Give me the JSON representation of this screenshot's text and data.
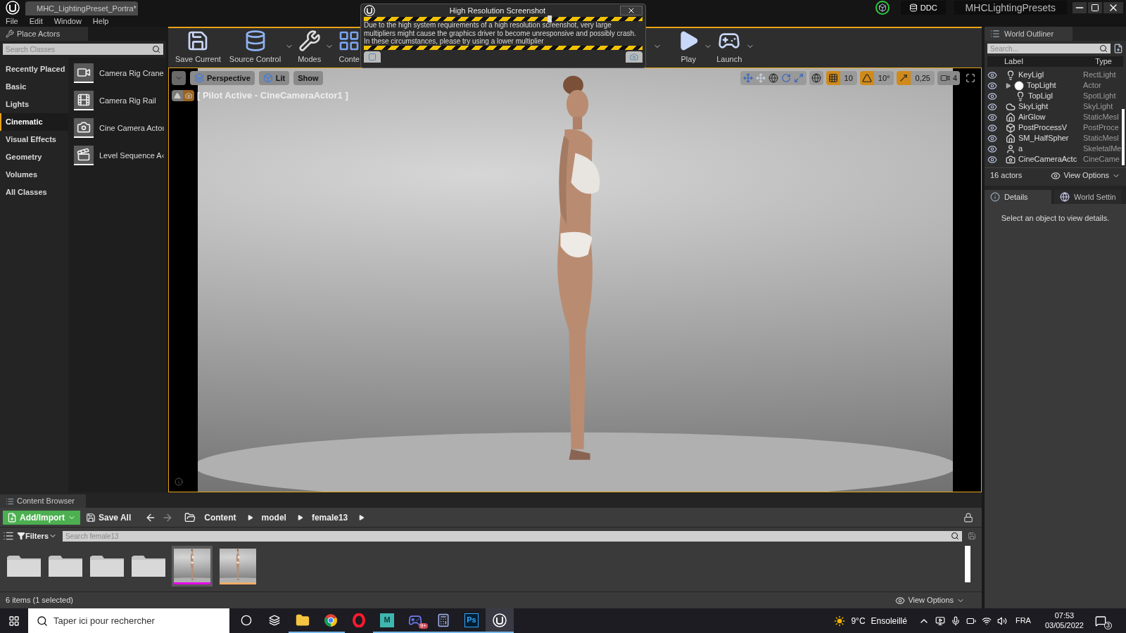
{
  "title_bar": {
    "tab": "MHC_LightingPreset_Portra*",
    "ddc": "DDC",
    "project": "MHCLightingPresets"
  },
  "menu": [
    "File",
    "Edit",
    "Window",
    "Help"
  ],
  "place_actors": {
    "title": "Place Actors",
    "search_placeholder": "Search Classes",
    "categories": [
      {
        "label": "Recently Placed",
        "selected": false
      },
      {
        "label": "Basic",
        "selected": false
      },
      {
        "label": "Lights",
        "selected": false
      },
      {
        "label": "Cinematic",
        "selected": true
      },
      {
        "label": "Visual Effects",
        "selected": false
      },
      {
        "label": "Geometry",
        "selected": false
      },
      {
        "label": "Volumes",
        "selected": false
      },
      {
        "label": "All Classes",
        "selected": false
      }
    ],
    "items": [
      {
        "label": "Camera Rig Crane",
        "kind": "crane"
      },
      {
        "label": "Camera Rig Rail",
        "kind": "rail"
      },
      {
        "label": "Cine Camera Actoı",
        "kind": "camera"
      },
      {
        "label": "Level Sequence A‹",
        "kind": "sequence"
      }
    ]
  },
  "toolbar": {
    "left": [
      {
        "label": "Save Current",
        "kind": "save",
        "menu": false
      },
      {
        "label": "Source Control",
        "kind": "source",
        "menu": true
      },
      {
        "label": "Modes",
        "kind": "modes",
        "menu": true
      },
      {
        "label": "Conte",
        "kind": "content",
        "menu": false
      }
    ],
    "right": [
      {
        "label": "Play",
        "kind": "play",
        "menu": true
      },
      {
        "label": "Launch",
        "kind": "launch",
        "menu": true
      }
    ]
  },
  "screenshot_dialog": {
    "title": "High Resolution Screenshot",
    "message": "Due to the high system requirements of a high resolution screenshot, very large multipliers might cause the graphics driver to become unresponsive and possibly crash. In these circumstances, please try using a lower multiplier",
    "multiplier": {
      "level": 0.66
    }
  },
  "viewport": {
    "view_buttons": [
      {
        "label": "Perspective",
        "kind": "perspective"
      },
      {
        "label": "Lit",
        "kind": "lit"
      },
      {
        "label": "Show",
        "kind": "show"
      }
    ],
    "pilot_label": "[ Pilot Active - CineCameraActor1 ]",
    "snaps": [
      {
        "kind": "grid",
        "value": "10",
        "on": true
      },
      {
        "kind": "rotation",
        "value": "10°",
        "on": true
      },
      {
        "kind": "scale",
        "value": "0,25",
        "on": true
      }
    ],
    "camera_speed": "4"
  },
  "world_outliner": {
    "title": "World Outliner",
    "search_placeholder": "Search...",
    "columns": [
      "Label",
      "Type"
    ],
    "rows": [
      {
        "label": "KeyLigl",
        "type": "RectLight",
        "kind": "rectlight"
      },
      {
        "label": "TopLight",
        "type": "Actor",
        "kind": "actor",
        "expanded": true,
        "children": [
          {
            "label": "TopLigl",
            "type": "SpotLight",
            "kind": "spotlight"
          }
        ]
      },
      {
        "label": "SkyLight",
        "type": "SkyLight",
        "kind": "skylight"
      },
      {
        "label": "AirGlow",
        "type": "StaticMesl",
        "kind": "mesh"
      },
      {
        "label": "PostProcessV",
        "type": "PostProce",
        "kind": "postprocess"
      },
      {
        "label": "SM_HalfSpher",
        "type": "StaticMesl",
        "kind": "mesh"
      },
      {
        "label": "a",
        "type": "SkeletalMe",
        "kind": "skeletal"
      },
      {
        "label": "CineCameraActc",
        "type": "CineCame",
        "kind": "camera"
      }
    ],
    "actor_count": "16 actors",
    "view_options": "View Options"
  },
  "details": {
    "tabs": [
      {
        "label": "Details",
        "selected": true
      },
      {
        "label": "World Settin",
        "selected": false
      }
    ],
    "empty_message": "Select an object to view details."
  },
  "content_browser": {
    "title": "Content Browser",
    "add_import": "Add/Import",
    "save_all": "Save All",
    "path": [
      "Content",
      "model",
      "female13"
    ],
    "filters": "Filters",
    "search_placeholder": "Search female13",
    "assets": [
      {
        "kind": "folder",
        "selected": false
      },
      {
        "kind": "folder",
        "selected": false
      },
      {
        "kind": "folder",
        "selected": false
      },
      {
        "kind": "folder",
        "selected": false
      },
      {
        "kind": "picture",
        "selected": true,
        "color": "#e600e6"
      },
      {
        "kind": "picture",
        "selected": false,
        "color": "#f5ad6b"
      }
    ],
    "status": "6 items (1 selected)",
    "view_options": "View Options"
  },
  "taskbar": {
    "search_placeholder": "Taper ici pour rechercher",
    "apps": [
      {
        "kind": "cortana",
        "open": false,
        "active": false
      },
      {
        "kind": "taskview",
        "open": false,
        "active": false
      },
      {
        "kind": "explorer",
        "open": true,
        "active": false
      },
      {
        "kind": "chrome",
        "open": true,
        "active": false
      },
      {
        "kind": "opera",
        "open": false,
        "active": false
      },
      {
        "kind": "maya",
        "label": "M",
        "open": true,
        "active": false
      },
      {
        "kind": "discord",
        "badge": "9+",
        "open": true,
        "active": false
      },
      {
        "kind": "calculator",
        "open": true,
        "active": false
      },
      {
        "kind": "photoshop",
        "label": "Ps",
        "open": true,
        "active": false
      },
      {
        "kind": "unreal",
        "open": true,
        "active": true
      }
    ],
    "temperature": "9°C",
    "condition": "Ensoleillé",
    "language": "FRA",
    "time": "07:53",
    "date": "03/05/2022",
    "notifications": "3"
  }
}
